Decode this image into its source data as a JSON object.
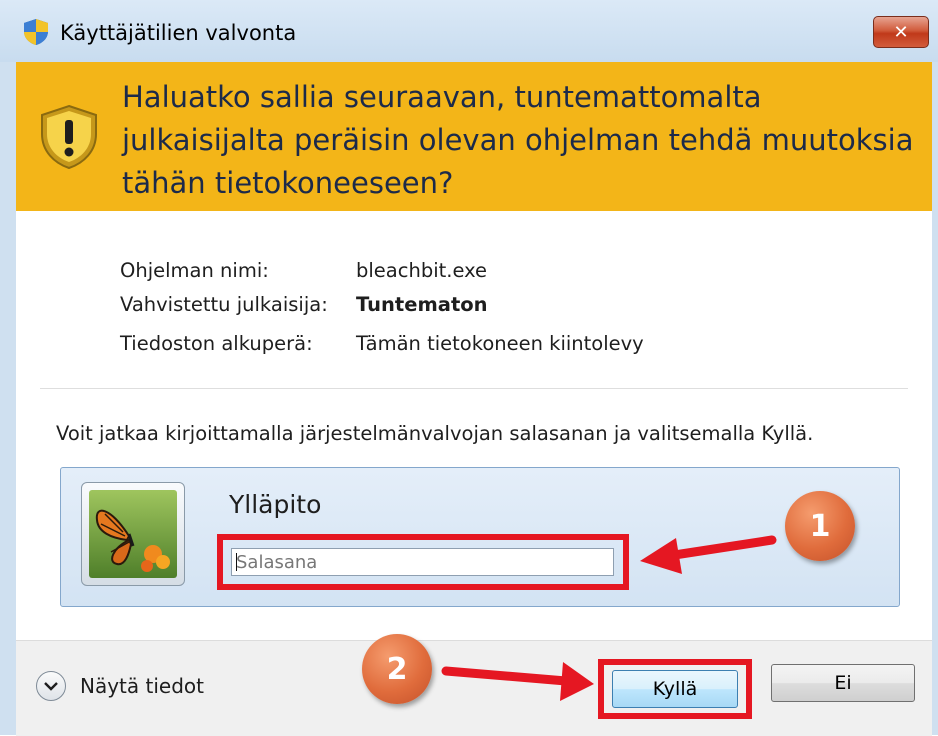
{
  "window": {
    "title": "Käyttäjätilien valvonta",
    "close_glyph": "✕",
    "accent_color": "#f3b518"
  },
  "banner": {
    "question": "Haluatko sallia seuraavan, tuntemattomalta julkaisijalta peräisin olevan ohjelman tehdä muutoksia tähän tietokoneeseen?",
    "icon": "warning-shield-icon"
  },
  "info": {
    "program_name_label": "Ohjelman nimi:",
    "program_name_value": "bleachbit.exe",
    "publisher_label": "Vahvistettu julkaisija:",
    "publisher_value": "Tuntematon",
    "origin_label": "Tiedoston alkuperä:",
    "origin_value": "Tämän tietokoneen kiintolevy"
  },
  "instruction": "Voit jatkaa kirjoittamalla järjestelmänvalvojan salasanan ja valitsemalla Kyllä.",
  "credential": {
    "username": "Ylläpito",
    "password_placeholder": "Salasana",
    "password_value": ""
  },
  "footer": {
    "details_label": "Näytä tiedot",
    "yes_label": "Kyllä",
    "no_label": "Ei"
  },
  "annotations": {
    "badge1": "1",
    "badge2": "2",
    "highlight_color": "#e51722"
  }
}
